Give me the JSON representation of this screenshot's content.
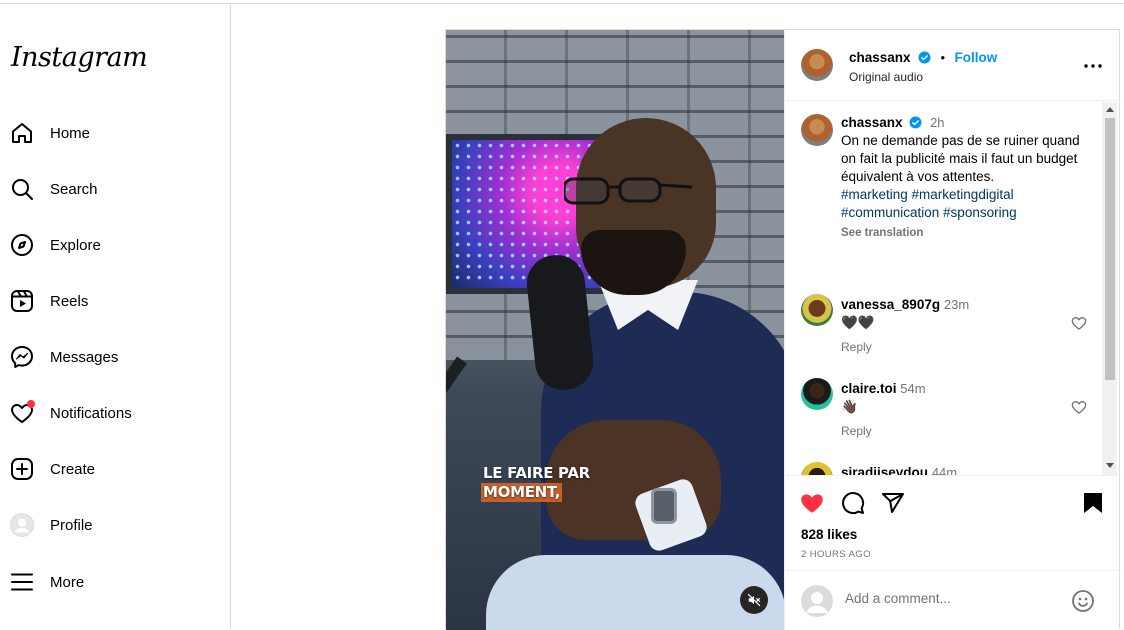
{
  "app": {
    "logo_text": "Instagram"
  },
  "sidebar": {
    "items": [
      {
        "label": "Home",
        "icon": "home-icon"
      },
      {
        "label": "Search",
        "icon": "search-icon"
      },
      {
        "label": "Explore",
        "icon": "compass-icon"
      },
      {
        "label": "Reels",
        "icon": "reels-icon"
      },
      {
        "label": "Messages",
        "icon": "messenger-icon"
      },
      {
        "label": "Notifications",
        "icon": "heart-icon",
        "badge_color": "#ff3040"
      },
      {
        "label": "Create",
        "icon": "plus-square-icon"
      },
      {
        "label": "Profile",
        "icon": "avatar-icon"
      },
      {
        "label": "More",
        "icon": "hamburger-icon"
      }
    ]
  },
  "post": {
    "author": "chassanx",
    "follow_label": "Follow",
    "dot": "•",
    "audio": "Original audio",
    "video_caption_lines": [
      "LE FAIRE PAR",
      "MOMENT,"
    ],
    "caption": {
      "author": "chassanx",
      "time": "2h",
      "text": "On ne demande pas de se ruiner quand on fait la publicité mais il faut un budget équivalent à vos attentes.",
      "hashtags": "#marketing #marketingdigital #communication #sponsoring",
      "see_translation": "See translation"
    },
    "comments": [
      {
        "user": "vanessa_8907g",
        "time": "23m",
        "text": "🖤🖤",
        "reply_label": "Reply"
      },
      {
        "user": "claire.toi",
        "time": "54m",
        "text": "👋🏿",
        "reply_label": "Reply"
      },
      {
        "user": "siradjiseydou",
        "time": "44m",
        "text": "😌😌"
      }
    ],
    "likes": "828 likes",
    "timestamp": "2 HOURS AGO",
    "add_comment_placeholder": "Add a comment...",
    "colors": {
      "accent": "#0095f6",
      "like_red": "#ff3040",
      "hashtag": "#00376b"
    }
  }
}
